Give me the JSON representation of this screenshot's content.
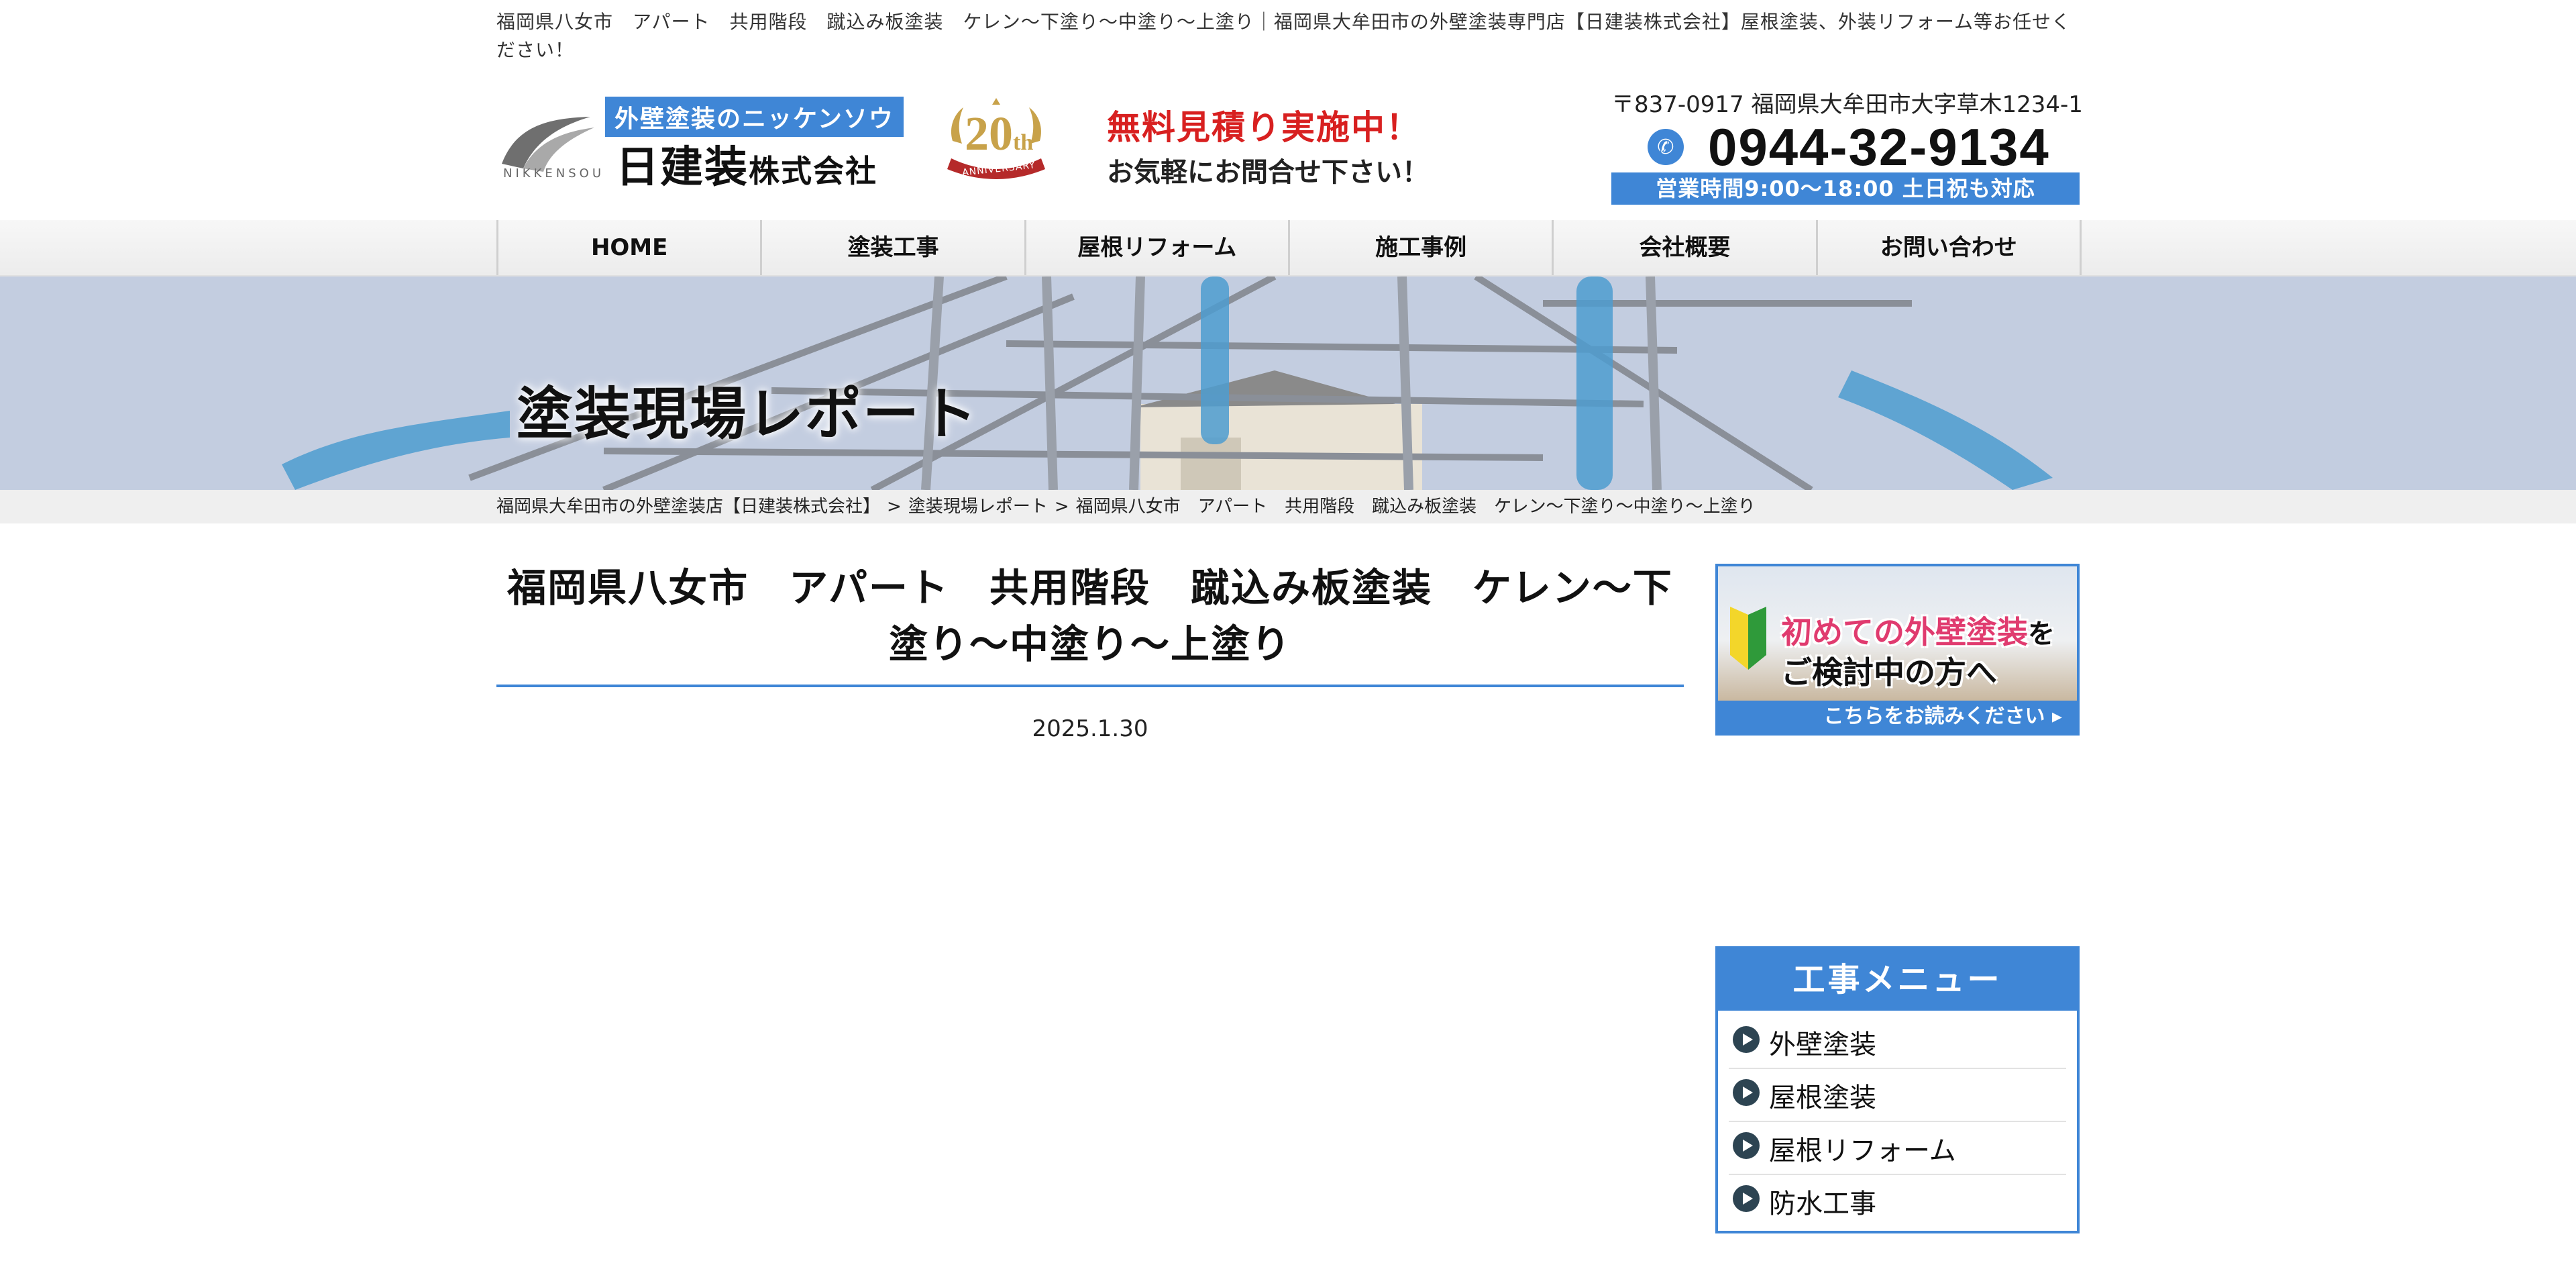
{
  "tagline": "福岡県八女市　アパート　共用階段　蹴込み板塗装　ケレン〜下塗り〜中塗り〜上塗り｜福岡県大牟田市の外壁塗装専門店【日建装株式会社】屋根塗装、外装リフォーム等お任せください！",
  "header": {
    "logo_subtitle": "外壁塗装のニッケンソウ",
    "logo_name": "日建装",
    "logo_name_suffix": "株式会社",
    "logo_brand": "NIKKENSOU",
    "anniversary_number": "20",
    "anniversary_suffix": "th",
    "anniversary_ribbon": "ANNIVERSARY",
    "promo_line1": "無料見積り実施中！",
    "promo_line2": "お気軽にお問合せ下さい！",
    "address": "〒837-0917 福岡県大牟田市大字草木1234-1",
    "phone": "0944-32-9134",
    "hours": "営業時間9:00〜18:00 土日祝も対応"
  },
  "nav": {
    "items": [
      "HOME",
      "塗装工事",
      "屋根リフォーム",
      "施工事例",
      "会社概要",
      "お問い合わせ"
    ]
  },
  "hero": {
    "title": "塗装現場レポート"
  },
  "breadcrumb": {
    "items": [
      "福岡県大牟田市の外壁塗装店【日建装株式会社】",
      "塗装現場レポート",
      "福岡県八女市　アパート　共用階段　蹴込み板塗装　ケレン〜下塗り〜中塗り〜上塗り"
    ],
    "separator": ">"
  },
  "article": {
    "title": "福岡県八女市　アパート　共用階段　蹴込み板塗装　ケレン〜下塗り〜中塗り〜上塗り",
    "date": "2025.1.30"
  },
  "sidebar": {
    "banner": {
      "line1": "初めての外壁塗装",
      "line1_suffix": "を",
      "line2": "ご検討中の方へ",
      "link": "こちらをお読みください ▸"
    },
    "menu": {
      "title": "工事メニュー",
      "items": [
        "外壁塗装",
        "屋根塗装",
        "屋根リフォーム",
        "防水工事"
      ]
    }
  },
  "colors": {
    "accent": "#3f86d6",
    "promo_red": "#d82020",
    "banner_pink": "#e03b6f"
  }
}
